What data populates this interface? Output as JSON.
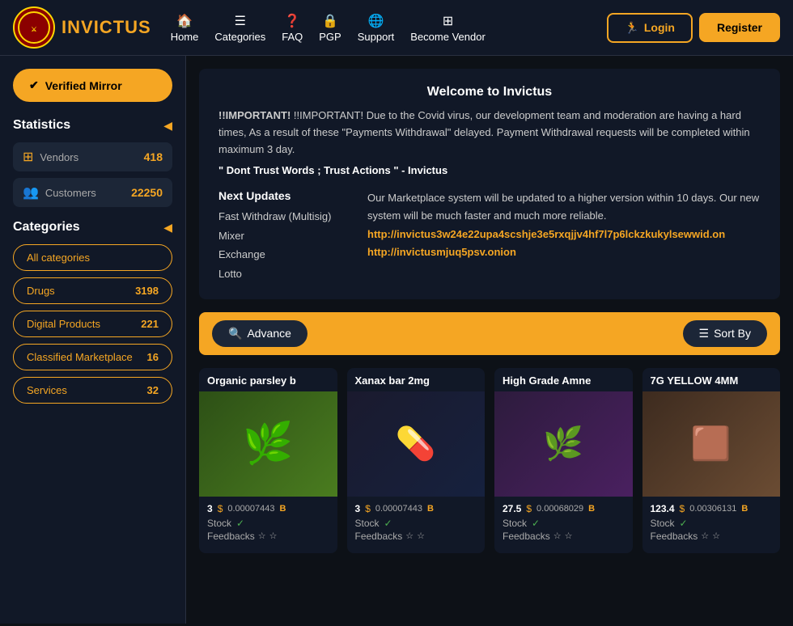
{
  "header": {
    "logo_text_pre": "IN",
    "logo_v": "V",
    "logo_text_post": "ICTUS",
    "nav": [
      {
        "label": "Home",
        "icon": "🏠"
      },
      {
        "label": "Categories",
        "icon": "☰"
      },
      {
        "label": "FAQ",
        "icon": "❓"
      },
      {
        "label": "PGP",
        "icon": "🔒"
      },
      {
        "label": "Support",
        "icon": "🌐"
      },
      {
        "label": "Become Vendor",
        "icon": "🔲"
      }
    ],
    "login_label": "Login",
    "register_label": "Register"
  },
  "sidebar": {
    "verified_mirror": "Verified Mirror",
    "statistics_title": "Statistics",
    "vendors_label": "Vendors",
    "vendors_count": "418",
    "customers_label": "Customers",
    "customers_count": "22250",
    "categories_title": "Categories",
    "categories": [
      {
        "label": "All categories",
        "count": ""
      },
      {
        "label": "Drugs",
        "count": "3198"
      },
      {
        "label": "Digital Products",
        "count": "221"
      },
      {
        "label": "Classified Marketplace",
        "count": "16"
      },
      {
        "label": "Services",
        "count": "32"
      }
    ]
  },
  "welcome": {
    "title": "Welcome to Invictus",
    "important_text": "!!IMPORTANT! Due to the Covid virus, our development team and moderation are having a hard times, As a result of these \"Payments Withdrawal\" delayed. Payment Withdrawal requests will be completed within maximum 3 day.",
    "quote": "\" Dont Trust Words ; Trust Actions \" - Invictus",
    "next_updates_title": "Next Updates",
    "updates_list": [
      "Fast Withdraw (Multisig)",
      "Mixer",
      "Exchange",
      "Lotto"
    ],
    "updates_desc": "Our Marketplace system will be updated to a higher version within 10 days. Our new system will be much faster and much more reliable.",
    "link1": "http://invictus3w24e22upa4scshje3e5rxqjjv4hf7l7p6lckzkukylsewwid.on",
    "link2": "http://invictusmjuq5psv.onion"
  },
  "toolbar": {
    "advance_label": "Advance",
    "sort_label": "Sort By"
  },
  "products": [
    {
      "title": "Organic parsley b",
      "price_usd": "3",
      "price_btc": "0.00007443",
      "stock": true,
      "feedbacks": "☆ ☆",
      "img_type": "green"
    },
    {
      "title": "Xanax bar 2mg",
      "price_usd": "3",
      "price_btc": "0.00007443",
      "stock": true,
      "feedbacks": "☆ ☆",
      "img_type": "dark"
    },
    {
      "title": "High Grade Amne",
      "price_usd": "27.5",
      "price_btc": "0.00068029",
      "stock": true,
      "feedbacks": "☆ ☆",
      "img_type": "purple"
    },
    {
      "title": "7G YELLOW 4MM",
      "price_usd": "123.4",
      "price_btc": "0.00306131",
      "stock": true,
      "feedbacks": "☆ ☆",
      "img_type": "brown"
    }
  ],
  "labels": {
    "stock": "Stock",
    "feedbacks": "Feedbacks",
    "check": "✓",
    "dollar": "$",
    "btc_symbol": "B"
  }
}
